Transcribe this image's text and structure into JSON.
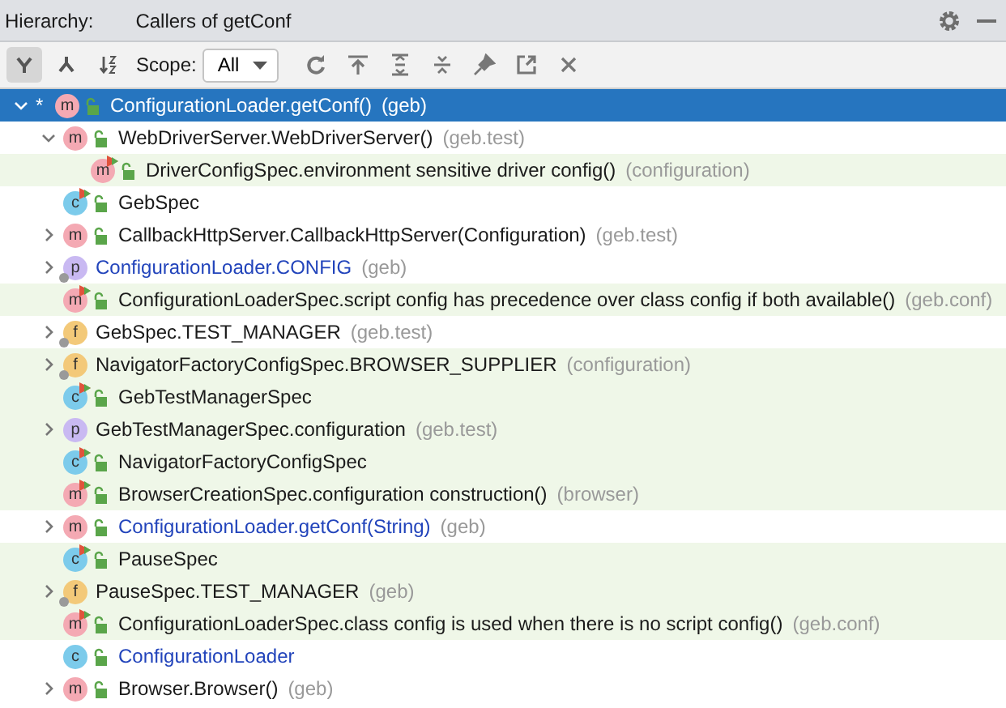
{
  "header": {
    "label": "Hierarchy:",
    "title": "Callers of getConf"
  },
  "toolbar": {
    "view_modes": [
      {
        "selected": true
      },
      {
        "selected": false
      },
      {
        "selected": false
      }
    ],
    "scope_label": "Scope:",
    "scope_value": "All"
  },
  "tree": [
    {
      "mark": "*",
      "kind": "method",
      "letter": "m",
      "locked": true,
      "static": false,
      "test_marker": false,
      "selected": true,
      "expanded": true,
      "name": "ConfigurationLoader.getConf()",
      "package": "(geb)",
      "children": [
        {
          "kind": "method",
          "letter": "m",
          "locked": true,
          "test": false,
          "static": false,
          "test_marker": false,
          "modified": false,
          "selected": false,
          "expanded": true,
          "name": "WebDriverServer.WebDriverServer()",
          "package": "(geb.test)",
          "children": [
            {
              "kind": "method",
              "letter": "m",
              "locked": true,
              "test": true,
              "static": false,
              "test_marker": true,
              "modified": false,
              "selected": false,
              "name": "DriverConfigSpec.environment sensitive driver config()",
              "package": "(configuration)"
            }
          ]
        },
        {
          "kind": "class",
          "letter": "c",
          "locked": true,
          "test": false,
          "static": false,
          "test_marker": true,
          "modified": false,
          "selected": false,
          "name": "GebSpec"
        },
        {
          "kind": "method",
          "letter": "m",
          "locked": true,
          "test": false,
          "static": false,
          "test_marker": false,
          "modified": false,
          "selected": false,
          "expanded": false,
          "name": "CallbackHttpServer.CallbackHttpServer(Configuration)",
          "package": "(geb.test)"
        },
        {
          "kind": "property",
          "letter": "p",
          "locked": false,
          "test": false,
          "static": true,
          "test_marker": false,
          "modified": true,
          "selected": false,
          "expanded": false,
          "name": "ConfigurationLoader.CONFIG",
          "package": "(geb)"
        },
        {
          "kind": "method",
          "letter": "m",
          "locked": true,
          "test": true,
          "static": false,
          "test_marker": true,
          "modified": false,
          "selected": false,
          "name": "ConfigurationLoaderSpec.script config has precedence over class config if both available()",
          "package": "(geb.conf)"
        },
        {
          "kind": "field",
          "letter": "f",
          "locked": false,
          "test": false,
          "static": true,
          "test_marker": false,
          "modified": false,
          "selected": false,
          "expanded": false,
          "name": "GebSpec.TEST_MANAGER",
          "package": "(geb.test)"
        },
        {
          "kind": "field",
          "letter": "f",
          "locked": false,
          "test": true,
          "static": true,
          "test_marker": false,
          "modified": false,
          "selected": false,
          "expanded": false,
          "name": "NavigatorFactoryConfigSpec.BROWSER_SUPPLIER",
          "package": "(configuration)"
        },
        {
          "kind": "class",
          "letter": "c",
          "locked": true,
          "test": true,
          "static": false,
          "test_marker": true,
          "modified": false,
          "selected": false,
          "name": "GebTestManagerSpec"
        },
        {
          "kind": "property",
          "letter": "p",
          "locked": false,
          "test": true,
          "static": false,
          "test_marker": false,
          "modified": false,
          "selected": false,
          "expanded": false,
          "name": "GebTestManagerSpec.configuration",
          "package": "(geb.test)"
        },
        {
          "kind": "class",
          "letter": "c",
          "locked": true,
          "test": true,
          "static": false,
          "test_marker": true,
          "modified": false,
          "selected": false,
          "name": "NavigatorFactoryConfigSpec"
        },
        {
          "kind": "method",
          "letter": "m",
          "locked": true,
          "test": true,
          "static": false,
          "test_marker": true,
          "modified": false,
          "selected": false,
          "name": "BrowserCreationSpec.configuration construction()",
          "package": "(browser)"
        },
        {
          "kind": "method",
          "letter": "m",
          "locked": true,
          "test": false,
          "static": false,
          "test_marker": false,
          "modified": true,
          "selected": false,
          "expanded": false,
          "name": "ConfigurationLoader.getConf(String)",
          "package": "(geb)"
        },
        {
          "kind": "class",
          "letter": "c",
          "locked": true,
          "test": true,
          "static": false,
          "test_marker": true,
          "modified": false,
          "selected": false,
          "name": "PauseSpec"
        },
        {
          "kind": "field",
          "letter": "f",
          "locked": false,
          "test": true,
          "static": true,
          "test_marker": false,
          "modified": false,
          "selected": false,
          "expanded": false,
          "name": "PauseSpec.TEST_MANAGER",
          "package": "(geb)"
        },
        {
          "kind": "method",
          "letter": "m",
          "locked": true,
          "test": true,
          "static": false,
          "test_marker": true,
          "modified": false,
          "selected": false,
          "name": "ConfigurationLoaderSpec.class config is used when there is no script config()",
          "package": "(geb.conf)"
        },
        {
          "kind": "class",
          "letter": "c",
          "locked": true,
          "test": false,
          "static": false,
          "test_marker": false,
          "modified": true,
          "selected": false,
          "name": "ConfigurationLoader"
        },
        {
          "kind": "method",
          "letter": "m",
          "locked": true,
          "test": false,
          "static": false,
          "test_marker": false,
          "modified": false,
          "selected": false,
          "expanded": false,
          "name": "Browser.Browser()",
          "package": "(geb)"
        }
      ]
    }
  ]
}
